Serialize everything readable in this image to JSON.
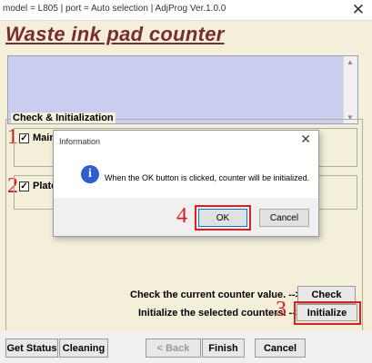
{
  "window": {
    "title": "model = L805 | port = Auto selection | AdjProg Ver.1.0.0",
    "close_glyph": "✕"
  },
  "header": {
    "title": "Waste ink pad counter"
  },
  "check_init": {
    "group_label": "Check & Initialization",
    "items": [
      {
        "marker": "1",
        "label": "Main",
        "checked": true
      },
      {
        "marker": "2",
        "label": "Plate",
        "checked": true
      }
    ],
    "check_text": "Check the current counter value. -->",
    "init_text": "Initialize the selected counters. -->",
    "check_button": "Check",
    "init_marker": "3",
    "init_button": "Initialize"
  },
  "bottom_bar": {
    "get_status": "Get Status",
    "cleaning": "Cleaning",
    "back": "< Back",
    "finish": "Finish",
    "cancel": "Cancel"
  },
  "dialog": {
    "title": "Information",
    "close_glyph": "✕",
    "icon": "info-icon",
    "message": "When the OK button is clicked, counter will be initialized.",
    "ok_marker": "4",
    "ok": "OK",
    "cancel": "Cancel"
  },
  "colors": {
    "header_text": "#7a2c2c",
    "panel_bg": "#f3efd9",
    "textbox_bg": "#c9ceee",
    "highlight": "#e11d1d",
    "info_icon": "#2d5fd0"
  }
}
